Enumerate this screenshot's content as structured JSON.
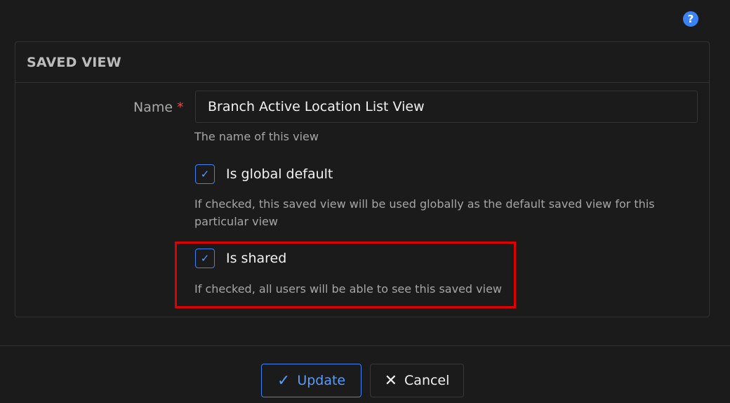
{
  "help_icon": {
    "glyph": "?",
    "name": "question-circle-icon"
  },
  "panel": {
    "title": "SAVED VIEW"
  },
  "form": {
    "name_label": "Name",
    "required_mark": "*",
    "name_value": "Branch Active Location List View",
    "name_hint": "The name of this view",
    "global_default": {
      "label": "Is global default",
      "checked": true,
      "hint_line1": "If checked, this saved view will be used globally as the default saved view for this",
      "hint_line2": "particular view"
    },
    "shared": {
      "label": "Is shared",
      "checked": true,
      "hint": "If checked, all users will be able to see this saved view"
    },
    "check_glyph": "✓"
  },
  "buttons": {
    "update": {
      "icon": "✓",
      "label": "Update"
    },
    "cancel": {
      "icon": "✕",
      "label": "Cancel"
    }
  },
  "colors": {
    "accent": "#3b82f6",
    "highlight": "#e10000",
    "required": "#e5484d",
    "background": "#1b1b1c"
  }
}
